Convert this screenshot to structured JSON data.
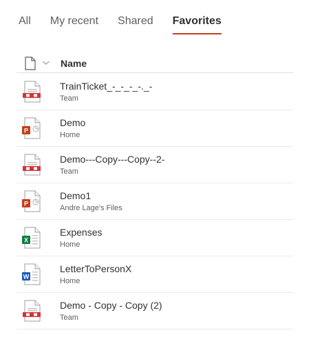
{
  "tabs": [
    {
      "label": "All",
      "active": false
    },
    {
      "label": "My recent",
      "active": false
    },
    {
      "label": "Shared",
      "active": false
    },
    {
      "label": "Favorites",
      "active": true
    }
  ],
  "header": {
    "name_label": "Name",
    "file_type_icon": "document-icon",
    "sort_icon": "chevron-down-icon"
  },
  "accent_color": "#c43e1c",
  "files": [
    {
      "name": "TrainTicket_-_-_-_-._-",
      "location": "Team",
      "type": "pdf"
    },
    {
      "name": "Demo",
      "location": "Home",
      "type": "pptx"
    },
    {
      "name": "Demo---Copy---Copy--2-",
      "location": "Team",
      "type": "pdf"
    },
    {
      "name": "Demo1",
      "location": "Andre Lage's Files",
      "type": "pptx"
    },
    {
      "name": "Expenses",
      "location": "Home",
      "type": "xlsx"
    },
    {
      "name": "LetterToPersonX",
      "location": "Home",
      "type": "docx"
    },
    {
      "name": "Demo - Copy - Copy (2)",
      "location": "Team",
      "type": "pdf"
    }
  ],
  "icon_colors": {
    "pdf": "#d13438",
    "pptx": "#c43e1c",
    "xlsx": "#107c41",
    "docx": "#185abd"
  }
}
